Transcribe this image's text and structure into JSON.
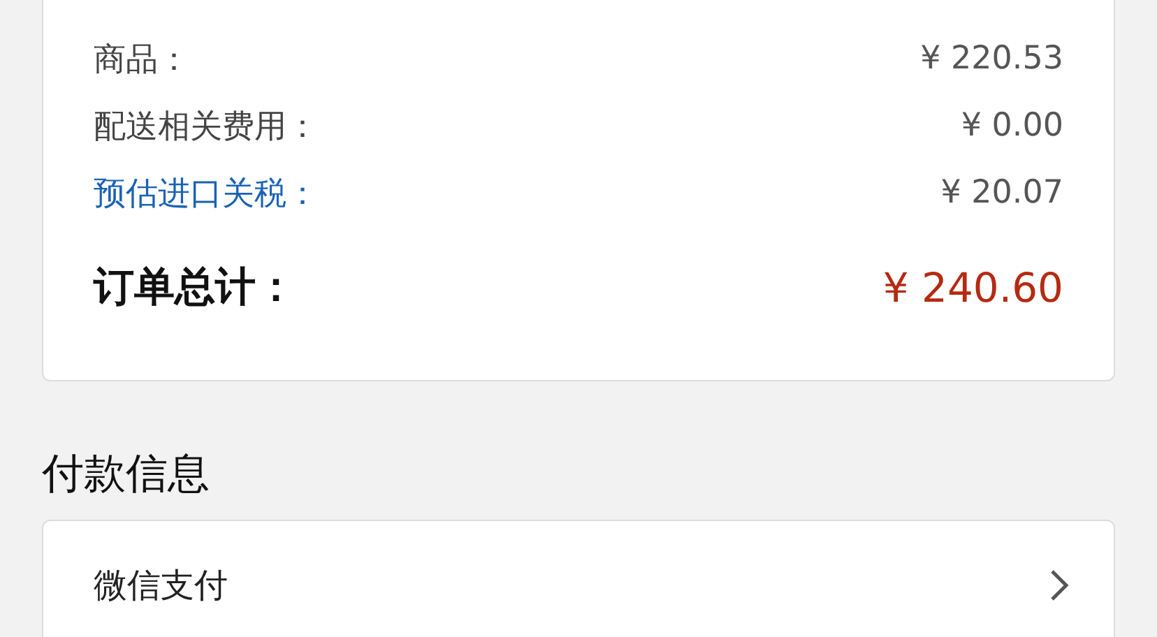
{
  "summary": {
    "rows": [
      {
        "kind": "plain",
        "label": "商品：",
        "value": "¥ 220.53"
      },
      {
        "kind": "plain",
        "label": "配送相关费用：",
        "value": "¥ 0.00"
      },
      {
        "kind": "link",
        "label": "预估进口关税：",
        "value": "¥ 20.07"
      }
    ],
    "total": {
      "label": "订单总计：",
      "value": "¥ 240.60"
    }
  },
  "payment": {
    "heading": "付款信息",
    "method": "微信支付"
  }
}
